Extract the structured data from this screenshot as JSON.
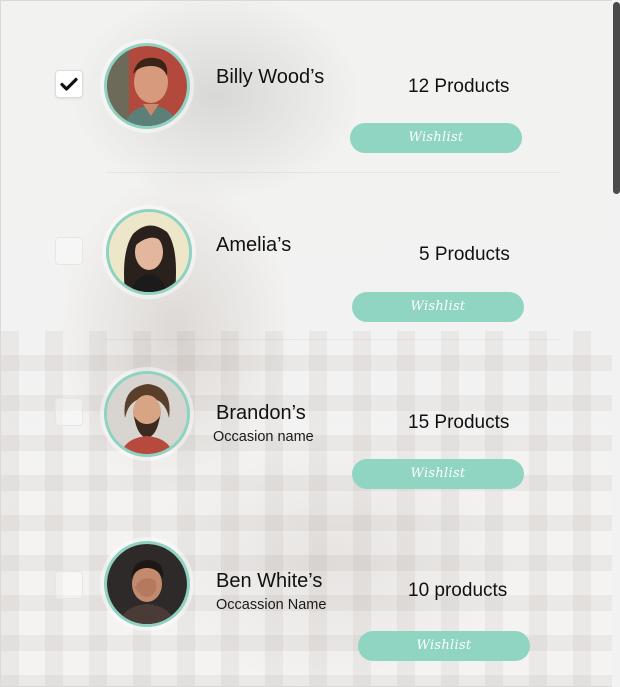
{
  "people": [
    {
      "name": "Billy Wood’s",
      "occasion": "",
      "products": "12 Products",
      "wishlist_label": "Wishlist",
      "checked": true
    },
    {
      "name": "Amelia’s",
      "occasion": "",
      "products": "5 Products",
      "wishlist_label": "Wishlist",
      "checked": false
    },
    {
      "name": "Brandon’s",
      "occasion": "Occasion name",
      "products": "15 Products",
      "wishlist_label": "Wishlist",
      "checked": false
    },
    {
      "name": "Ben White’s",
      "occasion": "Occassion Name",
      "products": "10 products",
      "wishlist_label": "Wishlist",
      "checked": false
    }
  ],
  "icons": {
    "check": "checkmark-icon"
  },
  "colors": {
    "accent": "#8fd5c2",
    "avatar_ring": "#8ed3c1",
    "text": "#111111"
  }
}
